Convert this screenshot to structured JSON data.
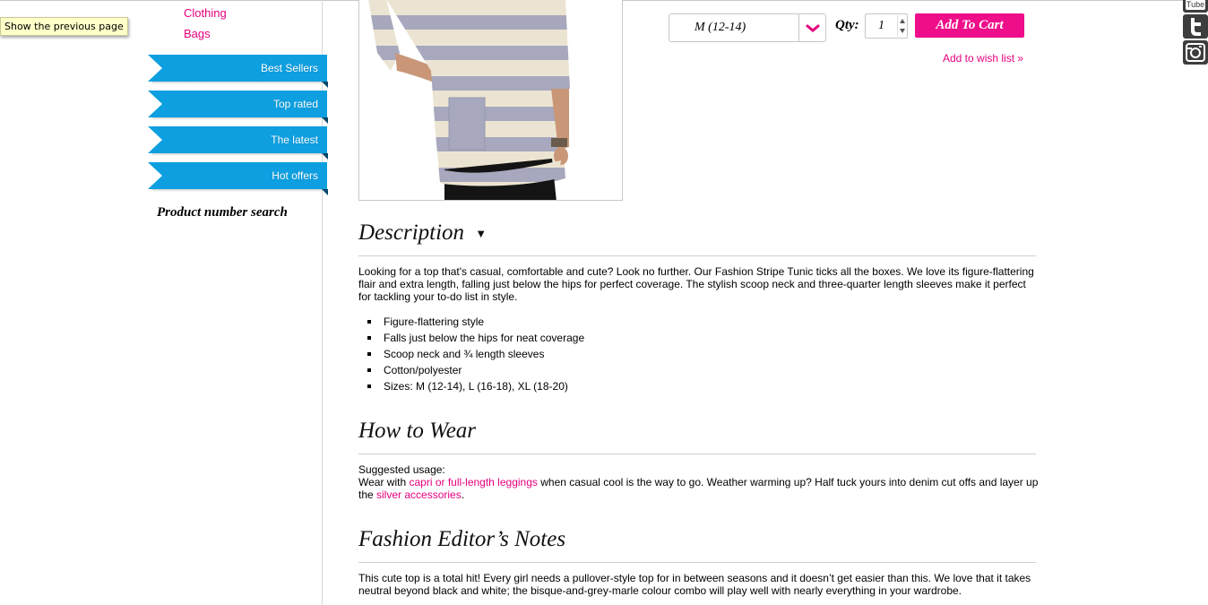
{
  "tooltip": "Show the previous page",
  "sidebar": {
    "categories": [
      "Clothing",
      "Bags"
    ],
    "ribbons": [
      "Best Sellers",
      "Top rated",
      "The latest",
      "Hot offers"
    ],
    "product_search_label": "Product number search"
  },
  "product": {
    "size_selected": "M (12-14)",
    "qty_label": "Qty:",
    "qty_value": "1",
    "add_to_cart": "Add To Cart",
    "wishlist": "Add to wish list »"
  },
  "description": {
    "title": "Description",
    "text": "Looking for a top that's casual, comfortable and cute? Look no further. Our Fashion Stripe Tunic ticks all the boxes. We love its figure-flattering flair and extra length, falling just below the hips for perfect coverage. The stylish scoop neck and three-quarter length sleeves make it perfect for tackling your to-do list in style.",
    "bullets": [
      "Figure-flattering style",
      "Falls just below the hips for neat coverage",
      "Scoop neck and ¾ length sleeves",
      "Cotton/polyester",
      "Sizes: M (12-14), L (16-18), XL (18-20)"
    ]
  },
  "how_to_wear": {
    "title": "How to Wear",
    "intro": "Suggested usage:",
    "wear_with": "Wear with ",
    "link1": "capri or full-length leggings",
    "middle": " when casual cool is the way to go. Weather warming up? Half tuck yours into denim cut offs and layer up the ",
    "link2": "silver accessories",
    "end": "."
  },
  "editor_notes": {
    "title": "Fashion Editor’s Notes",
    "text": "This cute top is a total hit! Every girl needs a pullover-style top for in between seasons and it doesn’t get easier than this. We love that it takes neutral beyond black and white; the bisque-and-grey-marle colour combo will play well with nearly everything in your wardrobe."
  },
  "social": {
    "youtube_label": "Tube",
    "icons": [
      "youtube-icon",
      "twitter-icon",
      "instagram-icon"
    ]
  },
  "colors": {
    "accent_pink": "#e6007e",
    "ribbon_blue": "#0d9fe0"
  }
}
